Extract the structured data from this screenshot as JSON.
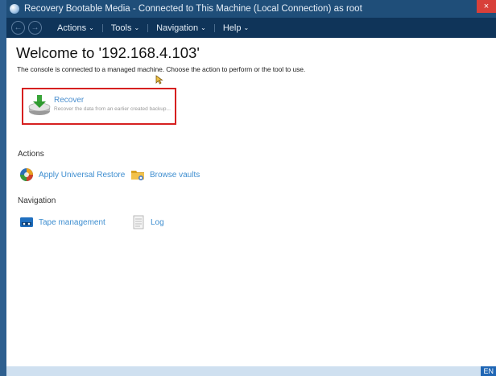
{
  "window": {
    "title": "Recovery Bootable Media - Connected to This Machine (Local Connection) as root",
    "close_label": "×"
  },
  "menu": {
    "back_glyph": "←",
    "forward_glyph": "→",
    "items": [
      {
        "label": "Actions",
        "chevron": "⌄"
      },
      {
        "label": "Tools",
        "chevron": "⌄"
      },
      {
        "label": "Navigation",
        "chevron": "⌄"
      },
      {
        "label": "Help",
        "chevron": "⌄"
      }
    ]
  },
  "main": {
    "heading": "Welcome to '192.168.4.103'",
    "subtitle": "The console is connected to a managed machine. Choose the action to perform or the tool to use.",
    "recover": {
      "title": "Recover",
      "description": "Recover the data from an earlier created backup..."
    },
    "actions_heading": "Actions",
    "actions": [
      {
        "label": "Apply Universal Restore",
        "icon": "universal-restore-icon"
      },
      {
        "label": "Browse vaults",
        "icon": "folder-icon"
      }
    ],
    "navigation_heading": "Navigation",
    "navigation": [
      {
        "label": "Tape management",
        "icon": "tape-icon"
      },
      {
        "label": "Log",
        "icon": "log-icon"
      }
    ]
  },
  "taskbar": {
    "language": "EN"
  },
  "colors": {
    "titlebar": "#1f4e79",
    "menubar": "#0f3459",
    "link": "#3e8ed0",
    "highlight_border": "#d62020"
  }
}
